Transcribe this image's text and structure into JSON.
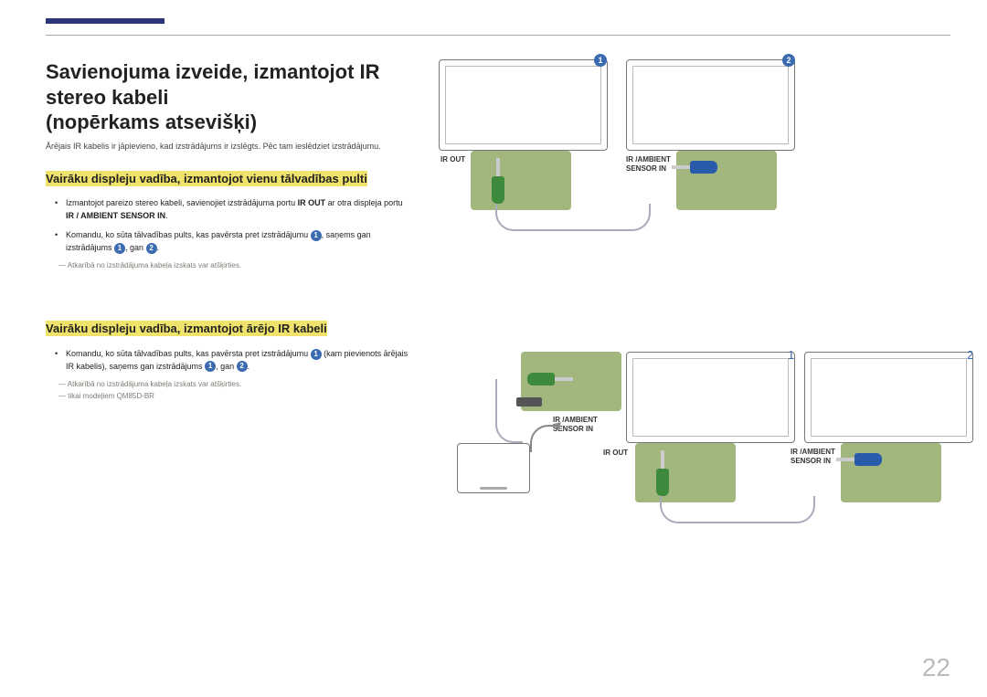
{
  "page_number": "22",
  "heading": {
    "line1": "Savienojuma izveide, izmantojot IR stereo kabeli",
    "line2": "(nopērkams atsevišķi)"
  },
  "intro_note": "Ārējais IR kabelis ir jāpievieno, kad izstrādājums ir izslēgts. Pēc tam ieslēdziet izstrādājumu.",
  "section1": {
    "title": "Vairāku displeju vadība, izmantojot vienu tālvadības pulti",
    "bullet1_a": "Izmantojot pareizo stereo kabeli, savienojiet izstrādājuma portu ",
    "bullet1_b": "IR OUT",
    "bullet1_c": " ar otra displeja portu ",
    "bullet1_d": "IR / AMBIENT SENSOR IN",
    "bullet1_e": ".",
    "bullet2_a": "Komandu, ko sūta tālvadības pults, kas pavērsta pret izstrādājumu ",
    "bullet2_b": ", saņems gan izstrādājums ",
    "bullet2_c": ", gan ",
    "bullet2_d": ".",
    "note1": "Atkarībā no izstrādājuma kabeļa izskats var atšķirties."
  },
  "section2": {
    "title": "Vairāku displeju vadība, izmantojot ārējo IR kabeli",
    "bullet1_a": "Komandu, ko sūta tālvadības pults, kas pavērsta pret izstrādājumu ",
    "bullet1_b": " (kam pievienots ārējais IR kabelis), saņems gan izstrādājums ",
    "bullet1_c": ", gan ",
    "bullet1_d": ".",
    "note1": "Atkarībā no izstrādājuma kabeļa izskats var atšķirties.",
    "note2": "tikai modeļiem QM85D-BR"
  },
  "labels": {
    "ir_out": "IR OUT",
    "ir_ambient": "IR /AMBIENT SENSOR IN",
    "n1": "1",
    "n2": "2"
  }
}
